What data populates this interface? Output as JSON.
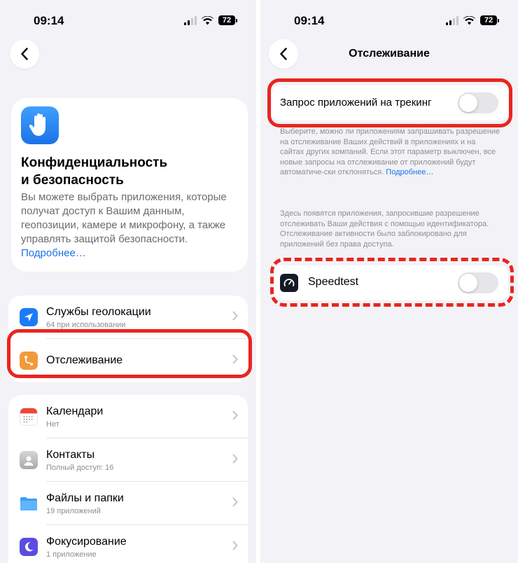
{
  "status_bar": {
    "time": "09:14",
    "battery": "72"
  },
  "left": {
    "privacy": {
      "title": "Конфиденциальность\nи безопасность",
      "description": "Вы можете выбрать приложения, которые получат доступ к Вашим данным, геопозиции, камере и микрофону, а также управлять защитой безопасности.",
      "more_link": "Подробнее…"
    },
    "group1": [
      {
        "title": "Службы геолокации",
        "subtitle": "64 при использовании",
        "icon": "location-arrow-icon",
        "color": "#1a7cf5"
      },
      {
        "title": "Отслеживание",
        "subtitle": "",
        "icon": "tracking-icon",
        "color": "#f29a3a"
      }
    ],
    "group2": [
      {
        "title": "Календари",
        "subtitle": "Нет",
        "icon": "calendar-icon"
      },
      {
        "title": "Контакты",
        "subtitle": "Полный доступ: 16",
        "icon": "contacts-icon"
      },
      {
        "title": "Файлы и папки",
        "subtitle": "19 приложений",
        "icon": "folder-icon",
        "color": "#3a9df5"
      },
      {
        "title": "Фокусирование",
        "subtitle": "1 приложение",
        "icon": "moon-icon",
        "color": "#5b4de0"
      }
    ]
  },
  "right": {
    "nav_title": "Отслеживание",
    "tracking_request": {
      "label": "Запрос приложений на трекинг",
      "enabled": false
    },
    "footnote1": "Выберите, можно ли приложениям запрашивать разрешение на отслеживание Ваших действий в приложениях и на сайтах других компаний. Если этот параметр выключен, все новые запросы на отслеживание от приложений будут автоматиче-ски отклоняться.",
    "footnote1_link": "Подробнее…",
    "footnote2": "Здесь появятся приложения, запросившие разрешение отслеживать Ваши действия с помощью идентификатора. Отслеживание активности было заблокировано для приложений без права доступа.",
    "app": {
      "name": "Speedtest",
      "enabled": false
    }
  },
  "colors": {
    "accent": "#1a73e8",
    "highlight": "#e8261f",
    "background": "#f2f2f7"
  }
}
